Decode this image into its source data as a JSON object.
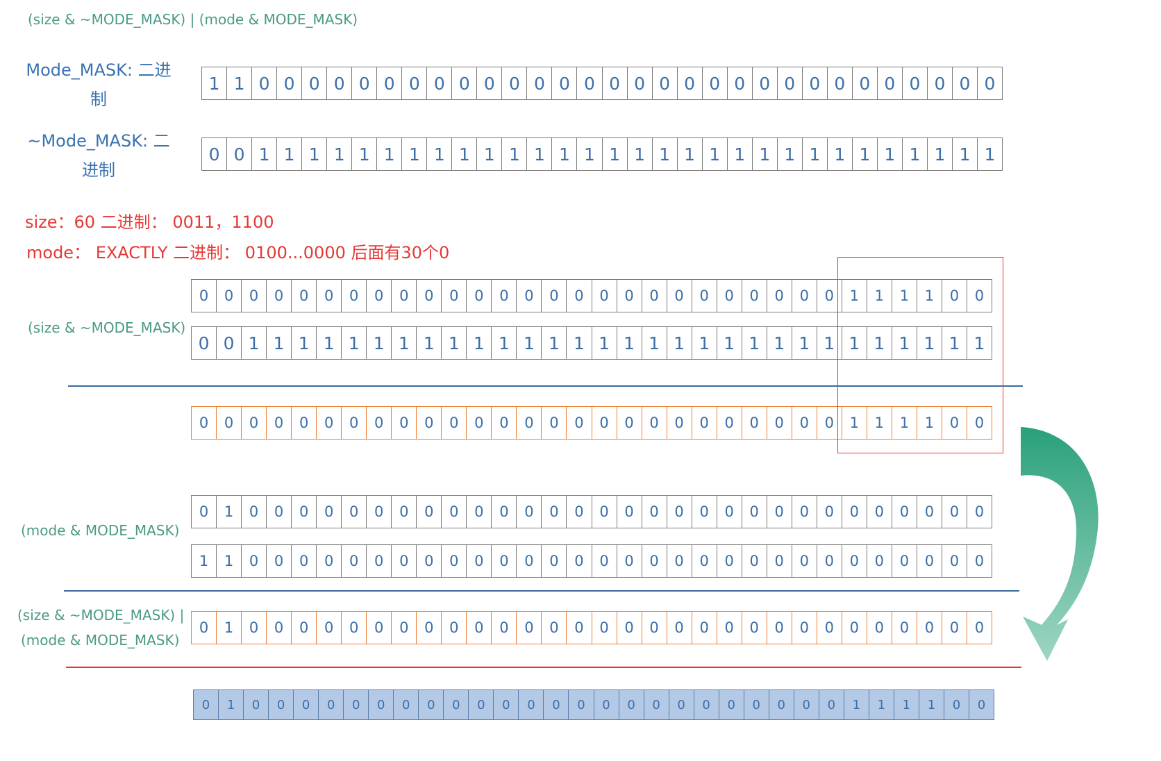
{
  "title": "(size & ~MODE_MASK) | (mode & MODE_MASK)",
  "mask_label": "Mode_MASK: 二进制",
  "not_mask_label": "~Mode_MASK: 二进制",
  "size_text": "size：60   二进制：  0011，1100",
  "mode_text": "mode：  EXACTLY 二进制：  0100...0000 后面有30个0",
  "size_and_label": "(size & ~MODE_MASK)",
  "mode_and_label": "(mode & MODE_MASK)",
  "or_label_line1": "(size & ~MODE_MASK) |",
  "or_label_line2": "(mode & MODE_MASK)",
  "colors": {
    "label_green": "#4a9a86",
    "label_blue": "#3a73b1",
    "red": "#e53935",
    "orange": "#ed7d31",
    "result_fill": "#b3c9e6",
    "arrow": "#3aa582"
  },
  "rows": {
    "mode_mask": "11000000000000000000000000000000",
    "not_mode_mask": "00111111111111111111111111111111",
    "size_bits": "00000000000000000000000000111100",
    "not_mask_operand": "00111111111111111111111111111111",
    "size_and_result": "00000000000000000000000000111100",
    "mode_bits": "01000000000000000000000000000000",
    "mask_operand": "11000000000000000000000000000000",
    "or_result": "01000000000000000000000000000000",
    "final_result": "01000000000000000000000000111100"
  }
}
